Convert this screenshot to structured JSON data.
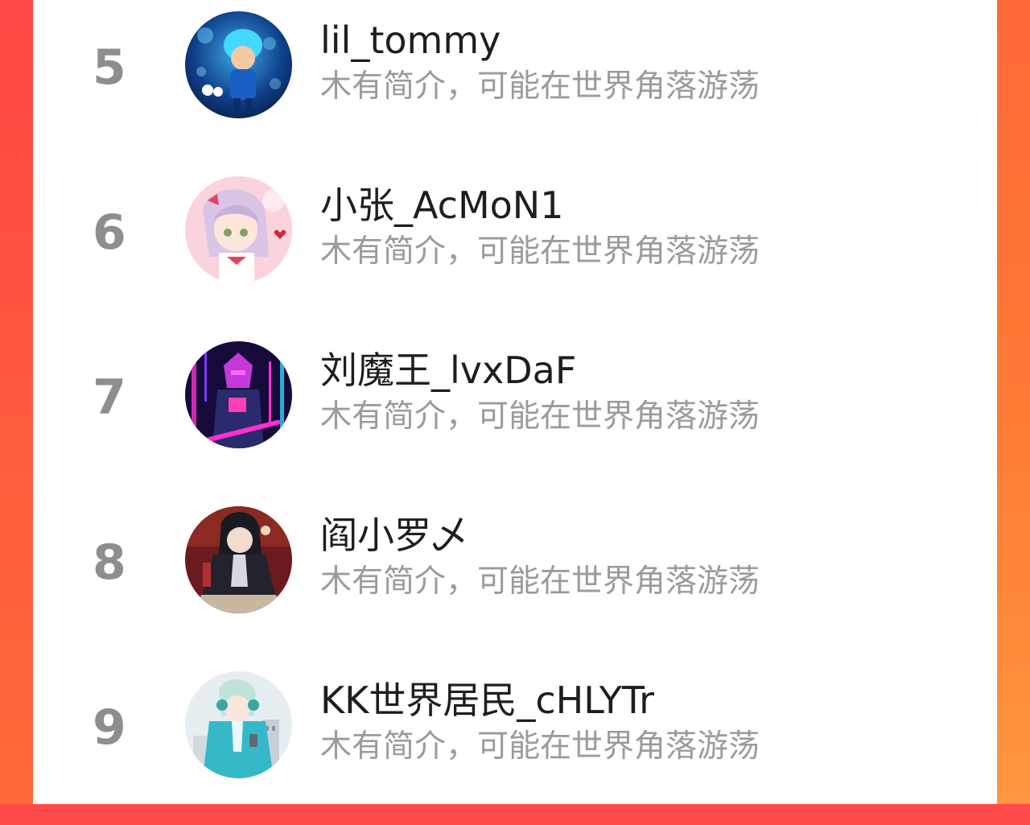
{
  "colors": {
    "background_gradient_start": "#ff4a4a",
    "background_gradient_end": "#ff7a34",
    "panel": "#ffffff",
    "rank_text": "#8e8e8e",
    "name_text": "#1e1e1e",
    "bio_text": "#9b9b9b"
  },
  "ranking": {
    "users": [
      {
        "rank": "5",
        "name": "lil_tommy",
        "bio": "木有简介，可能在世界角落游荡",
        "avatar_icon": "avatar-blue-boy-icon"
      },
      {
        "rank": "6",
        "name": "小张_AcMoN1",
        "bio": "木有简介，可能在世界角落游荡",
        "avatar_icon": "avatar-pink-anime-girl-icon"
      },
      {
        "rank": "7",
        "name": "刘魔王_lvxDaF",
        "bio": "木有简介，可能在世界角落游荡",
        "avatar_icon": "avatar-neon-character-icon"
      },
      {
        "rank": "8",
        "name": "阎小罗乄",
        "bio": "木有简介，可能在世界角落游荡",
        "avatar_icon": "avatar-dark-anime-warrior-icon"
      },
      {
        "rank": "9",
        "name": "KK世界居民_cHLYTr",
        "bio": "木有简介，可能在世界角落游荡",
        "avatar_icon": "avatar-teal-anime-boy-icon"
      }
    ]
  }
}
